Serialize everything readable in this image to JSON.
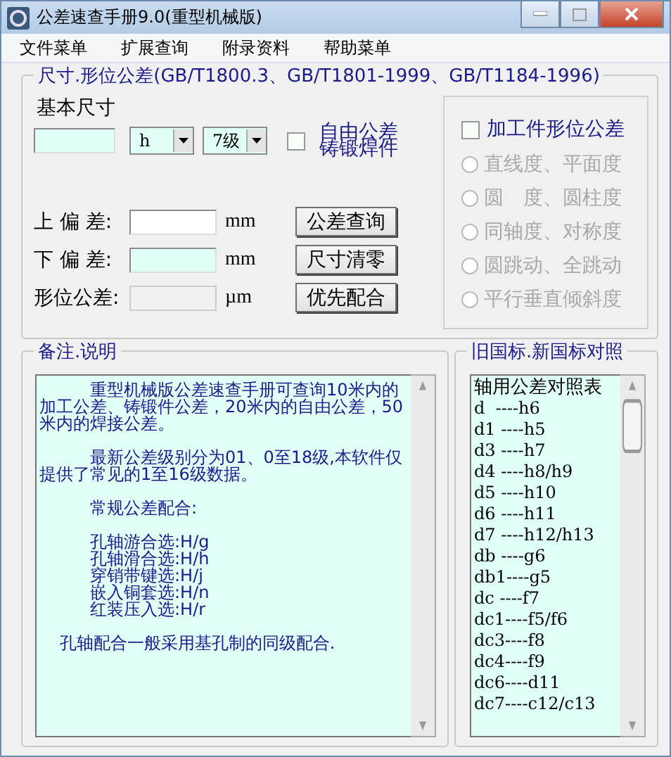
{
  "window": {
    "title": "公差速查手册9.0(重型机械版)"
  },
  "menu": [
    "文件菜单",
    "扩展查询",
    "附录资料",
    "帮助菜单"
  ],
  "tolerance": {
    "title": "尺寸.形位公差(GB/T1800.3、GB/T1801-1999、GB/T1184-1996)",
    "basic_size_label": "基本尺寸",
    "fit_select": "h",
    "grade_select": "7级",
    "free_checkbox": {
      "lines": [
        "自由公差",
        "铸锻焊件"
      ],
      "checked": false
    },
    "fields": [
      {
        "label": "上 偏 差:",
        "unit": "mm",
        "color": "#ffffff",
        "disabled": false
      },
      {
        "label": "下 偏 差:",
        "unit": "mm",
        "color": "#e0fff6",
        "disabled": false
      },
      {
        "label": "形位公差:",
        "unit": "µm",
        "color": "#f0f0f0",
        "disabled": true
      }
    ],
    "buttons": [
      "公差查询",
      "尺寸清零",
      "优先配合"
    ],
    "form_checkbox": {
      "label": "加工件形位公差",
      "checked": false
    },
    "radios": [
      {
        "label": "直线度、平面度",
        "selected": false,
        "disabled": true
      },
      {
        "label": "圆　度、圆柱度",
        "selected": false,
        "disabled": true
      },
      {
        "label": "同轴度、对称度",
        "selected": false,
        "disabled": true
      },
      {
        "label": "圆跳动、全跳动",
        "selected": false,
        "disabled": true
      },
      {
        "label": "平行垂直倾斜度",
        "selected": false,
        "disabled": true
      }
    ]
  },
  "notes": {
    "title": "备注.说明",
    "lines": [
      {
        "kind": "paragraph",
        "text": "重型机械版公差速查手册可查询10米内的加工公差、铸锻件公差，20米内的自由公差，50米内的焊接公差。"
      },
      {
        "kind": "paragraph",
        "text": "最新公差级别分为01、0至18级,本软件仅提供了常见的1至16级数据。"
      },
      {
        "kind": "paragraph",
        "text": "常规公差配合:"
      },
      {
        "kind": "item",
        "text": "孔轴游合选:H/g"
      },
      {
        "kind": "item",
        "text": "孔轴滑合选:H/h"
      },
      {
        "kind": "item",
        "text": "穿销带键选:H/j"
      },
      {
        "kind": "item",
        "text": "嵌入铜套选:H/n"
      },
      {
        "kind": "item",
        "text": "红装压入选:H/r"
      },
      {
        "kind": "footer",
        "text": "孔轴配合一般采用基孔制的同级配合."
      }
    ]
  },
  "comparison": {
    "title": "旧国标.新国标对照",
    "rows": [
      "轴用公差对照表",
      "d  ----h6",
      "d1 ----h5",
      "d3 ----h7",
      "d4 ----h8/h9",
      "d5 ----h10",
      "d6 ----h11",
      "d7 ----h12/h13",
      "db ----g6",
      "db1----g5",
      "dc ----f7",
      "dc1----f5/f6",
      "dc3----f8",
      "dc4----f9",
      "dc6----d11",
      "dc7----c12/c13"
    ]
  }
}
